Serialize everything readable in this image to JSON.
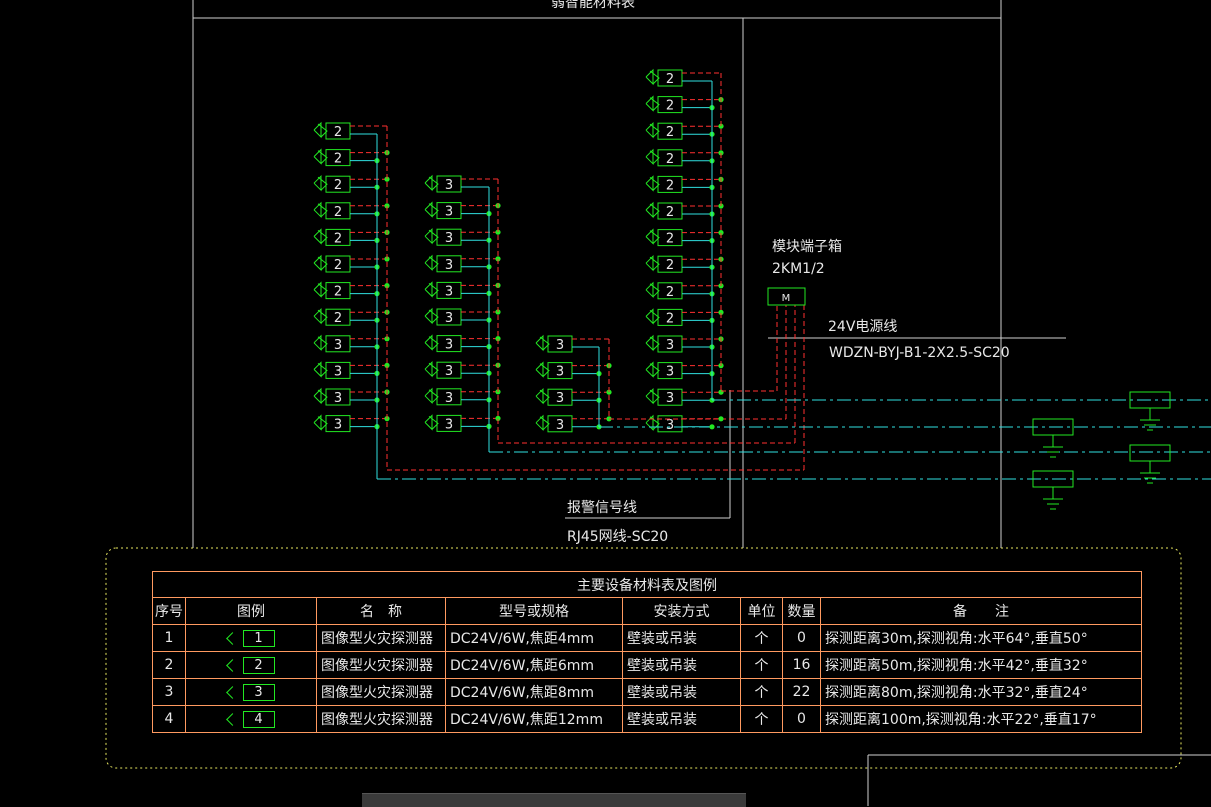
{
  "drawing": {
    "top_title": "弱智能材料表",
    "module_box_label": "模块端子箱",
    "module_box_id": "2KM1/2",
    "module_box_symbol": "M",
    "power_line_label": "24V电源线",
    "power_line_spec": "WDZN-BYJ-B1-2X2.5-SC20",
    "signal_line_label": "报警信号线",
    "signal_line_spec": "RJ45网线-SC20",
    "column1_detectors": [
      "2",
      "2",
      "2",
      "2",
      "2",
      "2",
      "2",
      "2",
      "3",
      "3",
      "3",
      "3"
    ],
    "column2_detectors": [
      "3",
      "3",
      "3",
      "3",
      "3",
      "3",
      "3",
      "3",
      "3",
      "3"
    ],
    "column3_detectors": [
      "3",
      "3",
      "3",
      "3"
    ],
    "column4_detectors": [
      "2",
      "2",
      "2",
      "2",
      "2",
      "2",
      "2",
      "2",
      "2",
      "2",
      "3",
      "3",
      "3",
      "3"
    ]
  },
  "table": {
    "caption": "主要设备材料表及图例",
    "headers": [
      "序号",
      "图例",
      "名　称",
      "型号或规格",
      "安装方式",
      "单位",
      "数量",
      "备　　注"
    ],
    "rows": [
      {
        "no": "1",
        "symbol": "1",
        "name": "图像型火灾探测器",
        "spec": "DC24V/6W,焦距4mm",
        "install": "壁装或吊装",
        "unit": "个",
        "qty": "0",
        "note": "探测距离30m,探测视角:水平64°,垂直50°"
      },
      {
        "no": "2",
        "symbol": "2",
        "name": "图像型火灾探测器",
        "spec": "DC24V/6W,焦距6mm",
        "install": "壁装或吊装",
        "unit": "个",
        "qty": "16",
        "note": "探测距离50m,探测视角:水平42°,垂直32°"
      },
      {
        "no": "3",
        "symbol": "3",
        "name": "图像型火灾探测器",
        "spec": "DC24V/6W,焦距8mm",
        "install": "壁装或吊装",
        "unit": "个",
        "qty": "22",
        "note": "探测距离80m,探测视角:水平32°,垂直24°"
      },
      {
        "no": "4",
        "symbol": "4",
        "name": "图像型火灾探测器",
        "spec": "DC24V/6W,焦距12mm",
        "install": "壁装或吊装",
        "unit": "个",
        "qty": "0",
        "note": "探测距离100m,探测视角:水平22°,垂直17°"
      }
    ]
  },
  "colors": {
    "background": "#000000",
    "frame": "#cfcfcf",
    "detector": "#22e822",
    "node": "#22e822",
    "power_wire": "#ff3030",
    "signal_wire": "#30e0e0",
    "table_border": "#ff9a60",
    "dotted_border": "#e8e860",
    "text": "#e8e8e8"
  }
}
